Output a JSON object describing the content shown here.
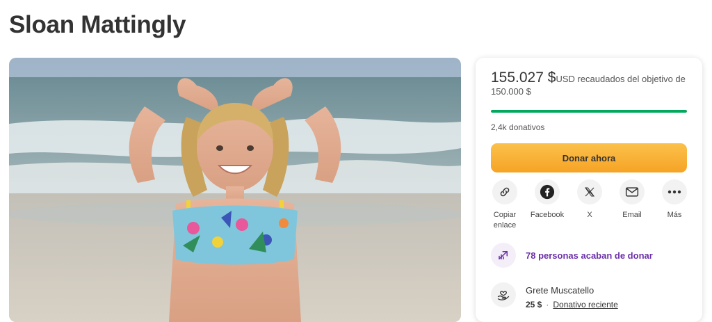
{
  "page": {
    "title": "Sloan Mattingly"
  },
  "hero": {
    "alt": "Niña en la playa formando un corazón con las manos"
  },
  "fundraiser": {
    "amount": "155.027 $",
    "currency": "USD",
    "raised_text": " recaudados del objetivo de",
    "goal": "150.000 $",
    "progress_fraction": 1.0,
    "donations_count": "2,4k donativos",
    "donate_label": "Donar ahora"
  },
  "share": {
    "items": [
      {
        "label": "Copiar enlace",
        "icon": "link-icon"
      },
      {
        "label": "Facebook",
        "icon": "facebook-icon"
      },
      {
        "label": "X",
        "icon": "x-logo-icon"
      },
      {
        "label": "Email",
        "icon": "email-icon"
      },
      {
        "label": "Más",
        "icon": "more-icon"
      }
    ]
  },
  "recent": {
    "text": "78 personas acaban de donar",
    "icon": "trending-icon"
  },
  "donor": {
    "name": "Grete Muscatello",
    "amount": "25 $",
    "separator": "·",
    "tag": "Donativo reciente",
    "icon": "donation-hands-icon"
  },
  "colors": {
    "progress": "#02a95c",
    "donate_button": "#f8b031",
    "recent_text": "#6b2fa8"
  }
}
